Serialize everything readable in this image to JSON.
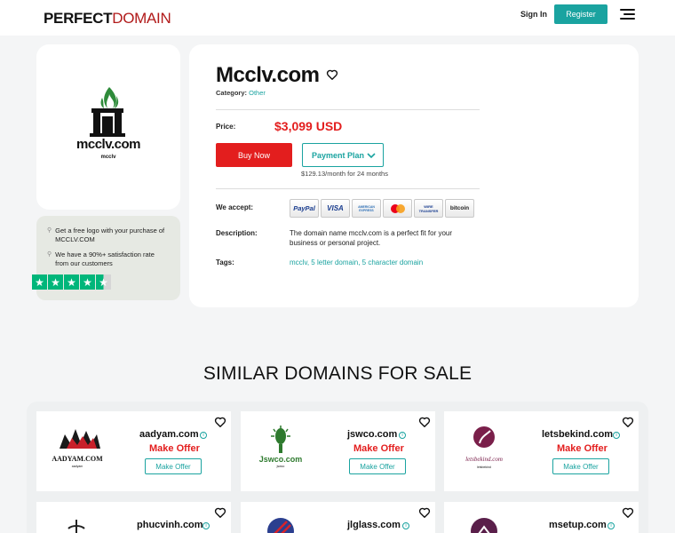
{
  "header": {
    "logo_part1": "PERFECT",
    "logo_part2": "DOMAIN",
    "signin": "Sign In",
    "register": "Register",
    "menu_icon": "hamburger-icon"
  },
  "logo_card": {
    "logo_text": "mcclv.com",
    "logo_subtext": "mcclv"
  },
  "trust": {
    "line1a": "Get a free logo with your purchase of",
    "line1b": "MCCLV.COM",
    "line2a": "We have a 90%+ satisfaction rate",
    "line2b": "from our customers",
    "stars": 4.5
  },
  "domain": {
    "name": "Mcclv.com",
    "category_label": "Category:",
    "category_value": "Other",
    "price_label": "Price:",
    "price": "$3,099 USD",
    "buy_now": "Buy Now",
    "payment_plan": "Payment Plan",
    "monthly": "$129.13/month for 24 months",
    "we_accept_label": "We accept:",
    "payment_methods": [
      "PayPal",
      "VISA",
      "AMERICAN EXPRESS",
      "mastercard",
      "WIRE TRANSFER",
      "bitcoin"
    ],
    "description_label": "Description:",
    "description": "The domain name mcclv.com is a perfect fit for your business or personal project.",
    "tags_label": "Tags:",
    "tags": "mcclv, 5 letter domain, 5 character domain"
  },
  "similar": {
    "heading": "SIMILAR DOMAINS FOR SALE",
    "items": [
      {
        "name": "aadyam.com",
        "make_offer": "Make Offer",
        "button": "Make Offer",
        "logo_text": "AADYAM.COM",
        "logo_sub": "aadyam"
      },
      {
        "name": "jswco.com",
        "make_offer": "Make Offer",
        "button": "Make Offer",
        "logo_text": "Jswco.com",
        "logo_sub": "jswco"
      },
      {
        "name": "letsbekind.com",
        "make_offer": "Make Offer",
        "button": "Make Offer",
        "logo_text": "letsbekind.com",
        "logo_sub": "letsbekind"
      },
      {
        "name": "phucvinh.com"
      },
      {
        "name": "jlglass.com"
      },
      {
        "name": "msetup.com"
      }
    ]
  },
  "colors": {
    "teal": "#1aa3a0",
    "red": "#e31e1e",
    "logo_red": "#b11a1a",
    "trustpilot_green": "#00b67a"
  }
}
